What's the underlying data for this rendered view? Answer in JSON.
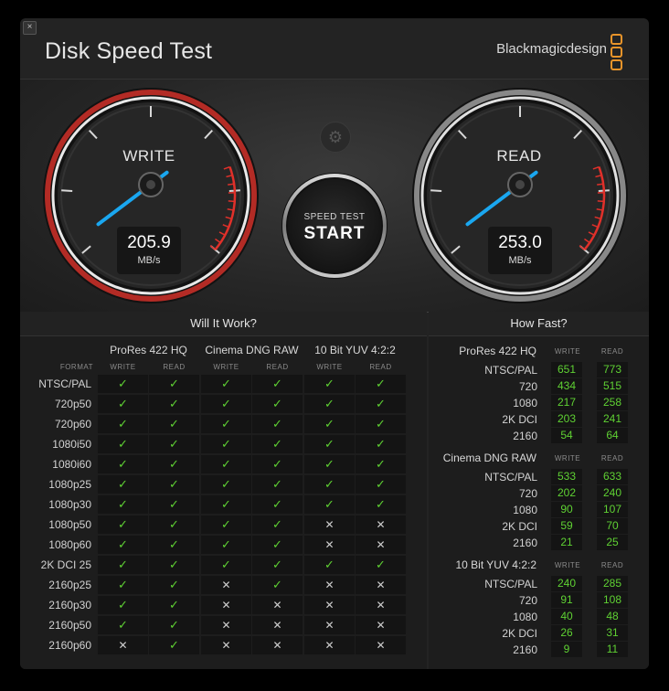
{
  "window": {
    "close_glyph": "×",
    "title": "Disk Speed Test",
    "brand": "Blackmagicdesign"
  },
  "colors": {
    "accent_green": "#5fd133",
    "needle_blue": "#1aa7f0",
    "redline": "#e0302a",
    "brand_orange": "#e8942a"
  },
  "icons": {
    "close": "close-icon",
    "settings": "gear-icon",
    "logo": "blackmagic-logo-icon"
  },
  "gauges": {
    "write": {
      "label": "WRITE",
      "value": "205.9",
      "unit": "MB/s"
    },
    "read": {
      "label": "READ",
      "value": "253.0",
      "unit": "MB/s"
    }
  },
  "start_button": {
    "small": "SPEED TEST",
    "big": "START"
  },
  "will_it_work": {
    "title": "Will It Work?",
    "format_label": "FORMAT",
    "write_label": "WRITE",
    "read_label": "READ",
    "codecs": [
      "ProRes 422 HQ",
      "Cinema DNG RAW",
      "10 Bit YUV 4:2:2"
    ],
    "rows": [
      {
        "format": "NTSC/PAL",
        "results": [
          1,
          1,
          1,
          1,
          1,
          1
        ]
      },
      {
        "format": "720p50",
        "results": [
          1,
          1,
          1,
          1,
          1,
          1
        ]
      },
      {
        "format": "720p60",
        "results": [
          1,
          1,
          1,
          1,
          1,
          1
        ]
      },
      {
        "format": "1080i50",
        "results": [
          1,
          1,
          1,
          1,
          1,
          1
        ]
      },
      {
        "format": "1080i60",
        "results": [
          1,
          1,
          1,
          1,
          1,
          1
        ]
      },
      {
        "format": "1080p25",
        "results": [
          1,
          1,
          1,
          1,
          1,
          1
        ]
      },
      {
        "format": "1080p30",
        "results": [
          1,
          1,
          1,
          1,
          1,
          1
        ]
      },
      {
        "format": "1080p50",
        "results": [
          1,
          1,
          1,
          1,
          0,
          0
        ]
      },
      {
        "format": "1080p60",
        "results": [
          1,
          1,
          1,
          1,
          0,
          0
        ]
      },
      {
        "format": "2K DCI 25",
        "results": [
          1,
          1,
          1,
          1,
          1,
          1
        ]
      },
      {
        "format": "2160p25",
        "results": [
          1,
          1,
          0,
          1,
          0,
          0
        ]
      },
      {
        "format": "2160p30",
        "results": [
          1,
          1,
          0,
          0,
          0,
          0
        ]
      },
      {
        "format": "2160p50",
        "results": [
          1,
          1,
          0,
          0,
          0,
          0
        ]
      },
      {
        "format": "2160p60",
        "results": [
          0,
          1,
          0,
          0,
          0,
          0
        ]
      }
    ],
    "check_glyph": "✓",
    "cross_glyph": "✕"
  },
  "how_fast": {
    "title": "How Fast?",
    "write_label": "WRITE",
    "read_label": "READ",
    "groups": [
      {
        "codec": "ProRes 422 HQ",
        "rows": [
          {
            "format": "NTSC/PAL",
            "write": "651",
            "read": "773"
          },
          {
            "format": "720",
            "write": "434",
            "read": "515"
          },
          {
            "format": "1080",
            "write": "217",
            "read": "258"
          },
          {
            "format": "2K DCI",
            "write": "203",
            "read": "241"
          },
          {
            "format": "2160",
            "write": "54",
            "read": "64"
          }
        ]
      },
      {
        "codec": "Cinema DNG RAW",
        "rows": [
          {
            "format": "NTSC/PAL",
            "write": "533",
            "read": "633"
          },
          {
            "format": "720",
            "write": "202",
            "read": "240"
          },
          {
            "format": "1080",
            "write": "90",
            "read": "107"
          },
          {
            "format": "2K DCI",
            "write": "59",
            "read": "70"
          },
          {
            "format": "2160",
            "write": "21",
            "read": "25"
          }
        ]
      },
      {
        "codec": "10 Bit YUV 4:2:2",
        "rows": [
          {
            "format": "NTSC/PAL",
            "write": "240",
            "read": "285"
          },
          {
            "format": "720",
            "write": "91",
            "read": "108"
          },
          {
            "format": "1080",
            "write": "40",
            "read": "48"
          },
          {
            "format": "2K DCI",
            "write": "26",
            "read": "31"
          },
          {
            "format": "2160",
            "write": "9",
            "read": "11"
          }
        ]
      }
    ]
  }
}
